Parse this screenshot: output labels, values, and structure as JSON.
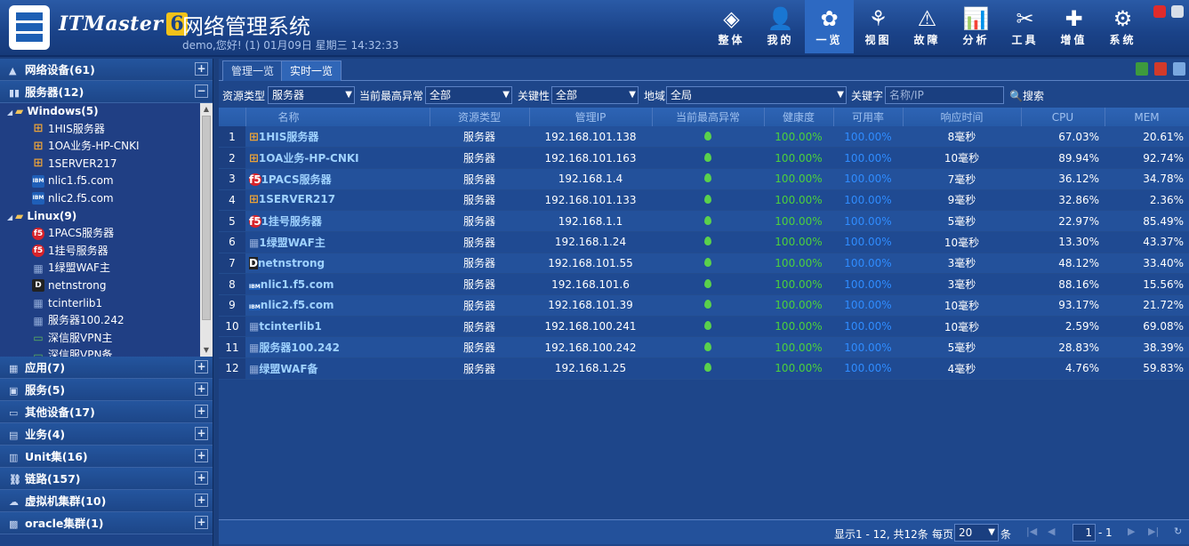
{
  "header": {
    "brand": "ITMaster",
    "version": "6",
    "title": "网络管理系统",
    "welcome": "demo,您好! (1) 01月09日 星期三 14:32:33"
  },
  "nav": [
    {
      "label": "整体",
      "icon": "layers-icon",
      "glyph": "◈"
    },
    {
      "label": "我的",
      "icon": "user-icon",
      "glyph": "👤"
    },
    {
      "label": "一览",
      "icon": "overview-icon",
      "glyph": "✿"
    },
    {
      "label": "视图",
      "icon": "topology-icon",
      "glyph": "⚘"
    },
    {
      "label": "故障",
      "icon": "warning-icon",
      "glyph": "⚠"
    },
    {
      "label": "分析",
      "icon": "chart-icon",
      "glyph": "📊"
    },
    {
      "label": "工具",
      "icon": "tools-icon",
      "glyph": "✂"
    },
    {
      "label": "增值",
      "icon": "plus-icon",
      "glyph": "✚"
    },
    {
      "label": "系统",
      "icon": "gear-icon",
      "glyph": "⚙"
    }
  ],
  "sidebar": {
    "cat_network": "网络设备(61)",
    "cat_server": "服务器(12)",
    "tree": [
      {
        "type": "group",
        "label": "Windows(5)"
      },
      {
        "type": "leaf",
        "label": "1HIS服务器",
        "icon": "win"
      },
      {
        "type": "leaf",
        "label": "1OA业务-HP-CNKI",
        "icon": "win"
      },
      {
        "type": "leaf",
        "label": "1SERVER217",
        "icon": "win"
      },
      {
        "type": "leaf",
        "label": "nlic1.f5.com",
        "icon": "ibm"
      },
      {
        "type": "leaf",
        "label": "nlic2.f5.com",
        "icon": "ibm"
      },
      {
        "type": "group",
        "label": "Linux(9)"
      },
      {
        "type": "leaf",
        "label": "1PACS服务器",
        "icon": "f5"
      },
      {
        "type": "leaf",
        "label": "1挂号服务器",
        "icon": "f5"
      },
      {
        "type": "leaf",
        "label": "1绿盟WAF主",
        "icon": "srv"
      },
      {
        "type": "leaf",
        "label": "netnstrong",
        "icon": "dark"
      },
      {
        "type": "leaf",
        "label": "tcinterlib1",
        "icon": "srv"
      },
      {
        "type": "leaf",
        "label": "服务器100.242",
        "icon": "srv"
      },
      {
        "type": "leaf",
        "label": "深信服VPN主",
        "icon": "pc"
      },
      {
        "type": "leaf",
        "label": "深信服VPN备",
        "icon": "pc"
      }
    ],
    "categories": [
      "应用(7)",
      "服务(5)",
      "其他设备(17)",
      "业务(4)",
      "Unit集(16)",
      "链路(157)",
      "虚拟机集群(10)",
      "oracle集群(1)"
    ]
  },
  "tabs": [
    "管理一览",
    "实时一览"
  ],
  "filters": {
    "type_label": "资源类型",
    "type_value": "服务器",
    "alarm_label": "当前最高异常",
    "alarm_value": "全部",
    "key_label": "关键性",
    "key_value": "全部",
    "region_label": "地域",
    "region_value": "全局",
    "keyword_label": "关键字",
    "keyword_placeholder": "名称/IP",
    "search_label": "搜索"
  },
  "table": {
    "columns": [
      "",
      "名称",
      "资源类型",
      "管理IP",
      "当前最高异常",
      "健康度",
      "可用率",
      "响应时间",
      "CPU",
      "MEM"
    ],
    "rows": [
      {
        "no": "1",
        "name": "1HIS服务器",
        "icon": "win",
        "type": "服务器",
        "ip": "192.168.101.138",
        "health": "100.00%",
        "avail": "100.00%",
        "resp": "8毫秒",
        "cpu": "67.03%",
        "mem": "20.61%"
      },
      {
        "no": "2",
        "name": "1OA业务-HP-CNKI",
        "icon": "win",
        "type": "服务器",
        "ip": "192.168.101.163",
        "health": "100.00%",
        "avail": "100.00%",
        "resp": "10毫秒",
        "cpu": "89.94%",
        "mem": "92.74%"
      },
      {
        "no": "3",
        "name": "1PACS服务器",
        "icon": "f5",
        "type": "服务器",
        "ip": "192.168.1.4",
        "health": "100.00%",
        "avail": "100.00%",
        "resp": "7毫秒",
        "cpu": "36.12%",
        "mem": "34.78%"
      },
      {
        "no": "4",
        "name": "1SERVER217",
        "icon": "win",
        "type": "服务器",
        "ip": "192.168.101.133",
        "health": "100.00%",
        "avail": "100.00%",
        "resp": "9毫秒",
        "cpu": "32.86%",
        "mem": "2.36%"
      },
      {
        "no": "5",
        "name": "1挂号服务器",
        "icon": "f5",
        "type": "服务器",
        "ip": "192.168.1.1",
        "health": "100.00%",
        "avail": "100.00%",
        "resp": "5毫秒",
        "cpu": "22.97%",
        "mem": "85.49%"
      },
      {
        "no": "6",
        "name": "1绿盟WAF主",
        "icon": "srv",
        "type": "服务器",
        "ip": "192.168.1.24",
        "health": "100.00%",
        "avail": "100.00%",
        "resp": "10毫秒",
        "cpu": "13.30%",
        "mem": "43.37%"
      },
      {
        "no": "7",
        "name": "netnstrong",
        "icon": "dark",
        "type": "服务器",
        "ip": "192.168.101.55",
        "health": "100.00%",
        "avail": "100.00%",
        "resp": "3毫秒",
        "cpu": "48.12%",
        "mem": "33.40%"
      },
      {
        "no": "8",
        "name": "nlic1.f5.com",
        "icon": "ibm",
        "type": "服务器",
        "ip": "192.168.101.6",
        "health": "100.00%",
        "avail": "100.00%",
        "resp": "3毫秒",
        "cpu": "88.16%",
        "mem": "15.56%"
      },
      {
        "no": "9",
        "name": "nlic2.f5.com",
        "icon": "ibm",
        "type": "服务器",
        "ip": "192.168.101.39",
        "health": "100.00%",
        "avail": "100.00%",
        "resp": "10毫秒",
        "cpu": "93.17%",
        "mem": "21.72%"
      },
      {
        "no": "10",
        "name": "tcinterlib1",
        "icon": "srv",
        "type": "服务器",
        "ip": "192.168.100.241",
        "health": "100.00%",
        "avail": "100.00%",
        "resp": "10毫秒",
        "cpu": "2.59%",
        "mem": "69.08%"
      },
      {
        "no": "11",
        "name": "服务器100.242",
        "icon": "srv",
        "type": "服务器",
        "ip": "192.168.100.242",
        "health": "100.00%",
        "avail": "100.00%",
        "resp": "5毫秒",
        "cpu": "28.83%",
        "mem": "38.39%"
      },
      {
        "no": "12",
        "name": "绿盟WAF备",
        "icon": "srv",
        "type": "服务器",
        "ip": "192.168.1.25",
        "health": "100.00%",
        "avail": "100.00%",
        "resp": "4毫秒",
        "cpu": "4.76%",
        "mem": "59.83%"
      }
    ]
  },
  "footer": {
    "summary": "显示1 - 12, 共12条",
    "per_page_label": "每页",
    "per_page": "20",
    "unit": "条",
    "page": "1",
    "total_pages": "1"
  },
  "icon_text": {
    "win": "⊞",
    "f5": "f5",
    "ibm": "IBM",
    "srv": "▦",
    "dark": "D",
    "pc": "▭"
  },
  "colors": {
    "win": "#e8a23a",
    "f5": "#d8232a",
    "ibm": "#1f5fb8",
    "srv": "#8ea8d6",
    "dark": "#222222",
    "pc": "#5fb85a",
    "healthy": "#4cd13c",
    "avail": "#2f8cff"
  }
}
